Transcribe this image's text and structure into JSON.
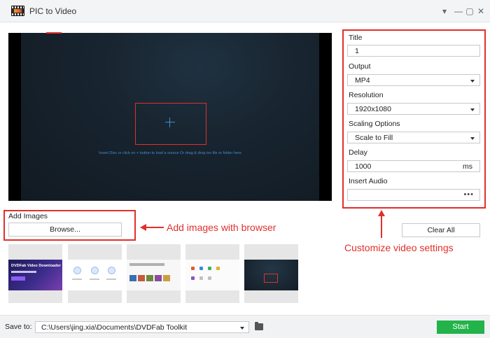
{
  "window": {
    "title": "PIC to Video",
    "controls": [
      "▾",
      "—",
      "▢",
      "✕"
    ]
  },
  "preview": {
    "hint": "Insert Disc or click on + button to load a source Or drag & drop iso file or folder here"
  },
  "settings": {
    "title_label": "Title",
    "title_value": "1",
    "output_label": "Output",
    "output_value": "MP4",
    "resolution_label": "Resolution",
    "resolution_value": "1920x1080",
    "scaling_label": "Scaling Options",
    "scaling_value": "Scale to Fill",
    "delay_label": "Delay",
    "delay_value": "1000",
    "delay_unit": "ms",
    "audio_label": "Insert Audio",
    "audio_more": "•••"
  },
  "actions": {
    "clear_all": "Clear All",
    "add_images_label": "Add Images",
    "browse": "Browse...",
    "start": "Start"
  },
  "annotations": {
    "add_images": "Add images with browser",
    "customize": "Customize video settings"
  },
  "thumbnail_text": {
    "t1": "DVDFab Video Downloader"
  },
  "bottom": {
    "save_label": "Save to:",
    "save_path": "C:\\Users\\jing.xia\\Documents\\DVDFab Toolkit"
  },
  "colors": {
    "accent_red": "#e0302c",
    "start_green": "#22b34a",
    "hint_blue": "#3d8fd1"
  }
}
